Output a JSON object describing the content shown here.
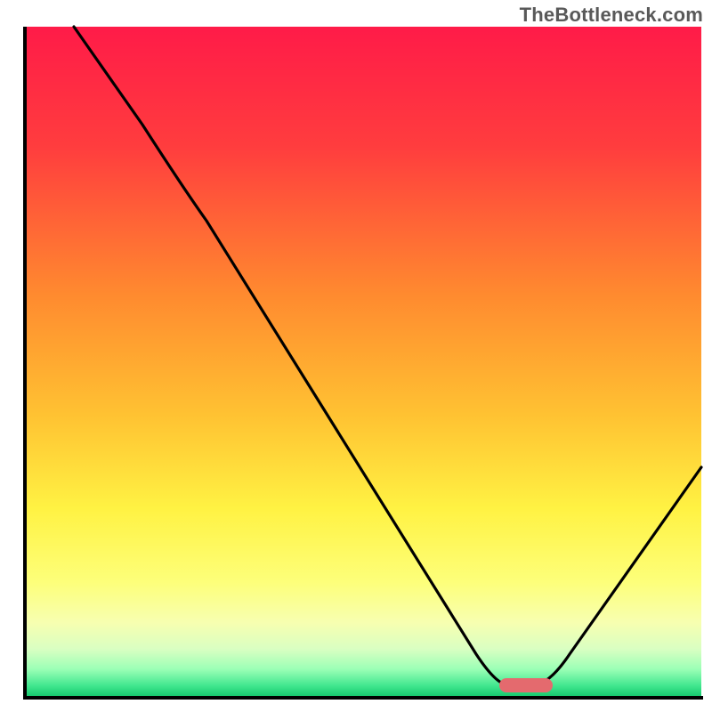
{
  "watermark": "TheBottleneck.com",
  "chart_data": {
    "type": "line",
    "title": "",
    "xlabel": "",
    "ylabel": "",
    "xlim": [
      0,
      100
    ],
    "ylim": [
      0,
      100
    ],
    "grid": false,
    "legend": false,
    "annotations": [],
    "background_gradient": {
      "stops": [
        {
          "offset": 0.0,
          "color": "#ff1b48"
        },
        {
          "offset": 0.18,
          "color": "#ff3d3e"
        },
        {
          "offset": 0.4,
          "color": "#ff8a2f"
        },
        {
          "offset": 0.58,
          "color": "#ffc232"
        },
        {
          "offset": 0.72,
          "color": "#fff243"
        },
        {
          "offset": 0.83,
          "color": "#fdff7a"
        },
        {
          "offset": 0.89,
          "color": "#f7ffb0"
        },
        {
          "offset": 0.93,
          "color": "#d9ffc2"
        },
        {
          "offset": 0.96,
          "color": "#9bffb6"
        },
        {
          "offset": 0.985,
          "color": "#40e68e"
        },
        {
          "offset": 1.0,
          "color": "#17c96f"
        }
      ]
    },
    "series": [
      {
        "name": "bottleneck-curve",
        "color": "#000000",
        "points": [
          {
            "x": 7,
            "y": 100
          },
          {
            "x": 22,
            "y": 80
          },
          {
            "x": 27,
            "y": 74
          },
          {
            "x": 67,
            "y": 6
          },
          {
            "x": 71,
            "y": 2
          },
          {
            "x": 75,
            "y": 2
          },
          {
            "x": 80,
            "y": 6
          },
          {
            "x": 100,
            "y": 34
          }
        ]
      }
    ],
    "markers": [
      {
        "name": "optimal-range-marker",
        "shape": "rounded-rect",
        "color": "#e46a6e",
        "x0": 70,
        "x1": 78,
        "y": 2
      }
    ]
  }
}
